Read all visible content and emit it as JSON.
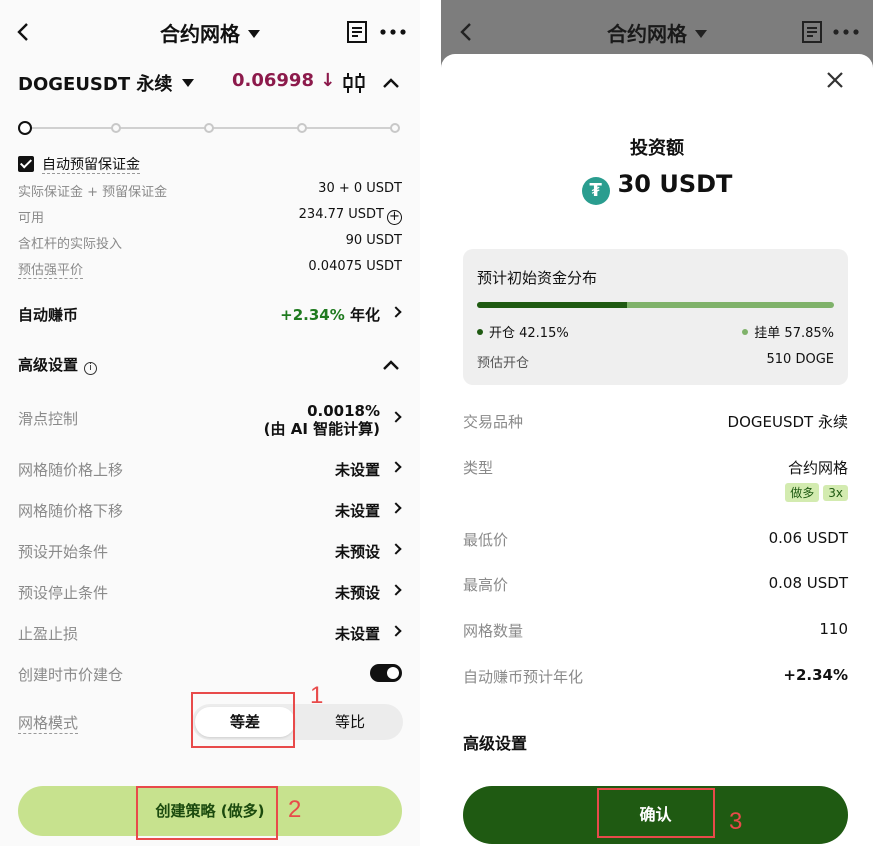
{
  "left": {
    "header": {
      "title": "合约网格"
    },
    "pair": {
      "name": "DOGEUSDT 永续",
      "price": "0.06998 ↓"
    },
    "auto_reserve": {
      "label": "自动预留保证金",
      "checked": true
    },
    "info": [
      {
        "label": "实际保证金 + 预留保证金",
        "value": "30 + 0 USDT"
      },
      {
        "label": "可用",
        "value": "234.77 USDT"
      },
      {
        "label": "含杠杆的实际投入",
        "value": "90 USDT"
      },
      {
        "label": "预估强平价",
        "value": "0.04075 USDT"
      }
    ],
    "auto_earn": {
      "label": "自动赚币",
      "rate": "+2.34%",
      "suffix": "年化"
    },
    "advanced": {
      "title": "高级设置",
      "info_icon": "i"
    },
    "slippage": {
      "label": "滑点控制",
      "value_line1": "0.0018%",
      "value_line2": "(由 AI 智能计算)"
    },
    "settings": [
      {
        "label": "网格随价格上移",
        "value": "未设置"
      },
      {
        "label": "网格随价格下移",
        "value": "未设置"
      },
      {
        "label": "预设开始条件",
        "value": "未预设"
      },
      {
        "label": "预设停止条件",
        "value": "未预设"
      },
      {
        "label": "止盈止损",
        "value": "未设置"
      }
    ],
    "market_open": {
      "label": "创建时市价建仓",
      "enabled": true
    },
    "grid_mode": {
      "label": "网格模式",
      "options": [
        "等差",
        "等比"
      ],
      "selected": "等差"
    },
    "create_button": "创建策略 (做多)"
  },
  "annotations": [
    "1",
    "2",
    "3"
  ],
  "right": {
    "header": {
      "title": "合约网格"
    },
    "invest": {
      "label": "投资额",
      "amount": "30 USDT",
      "token_glyph": "₮"
    },
    "distribution": {
      "title": "预计初始资金分布",
      "open_label": "开仓 42.15%",
      "order_label": "挂单 57.85%",
      "open_fraction": 0.4215,
      "est_label": "预估开仓",
      "est_value": "510 DOGE"
    },
    "details": [
      {
        "label": "交易品种",
        "value": "DOGEUSDT 永续"
      },
      {
        "label": "类型",
        "value": "合约网格"
      },
      {
        "label": "最低价",
        "value": "0.06 USDT"
      },
      {
        "label": "最高价",
        "value": "0.08 USDT"
      },
      {
        "label": "网格数量",
        "value": "110"
      },
      {
        "label": "自动赚币预计年化",
        "value": "+2.34%"
      }
    ],
    "type_tags": [
      "做多",
      "3x"
    ],
    "advanced_title": "高级设置",
    "confirm_button": "确认"
  },
  "colors": {
    "price_down": "#8c1a4b",
    "green": "#1f7a1f",
    "confirm": "#1f5a12",
    "create": "#c7e28e",
    "annotation": "#e84a4a"
  }
}
